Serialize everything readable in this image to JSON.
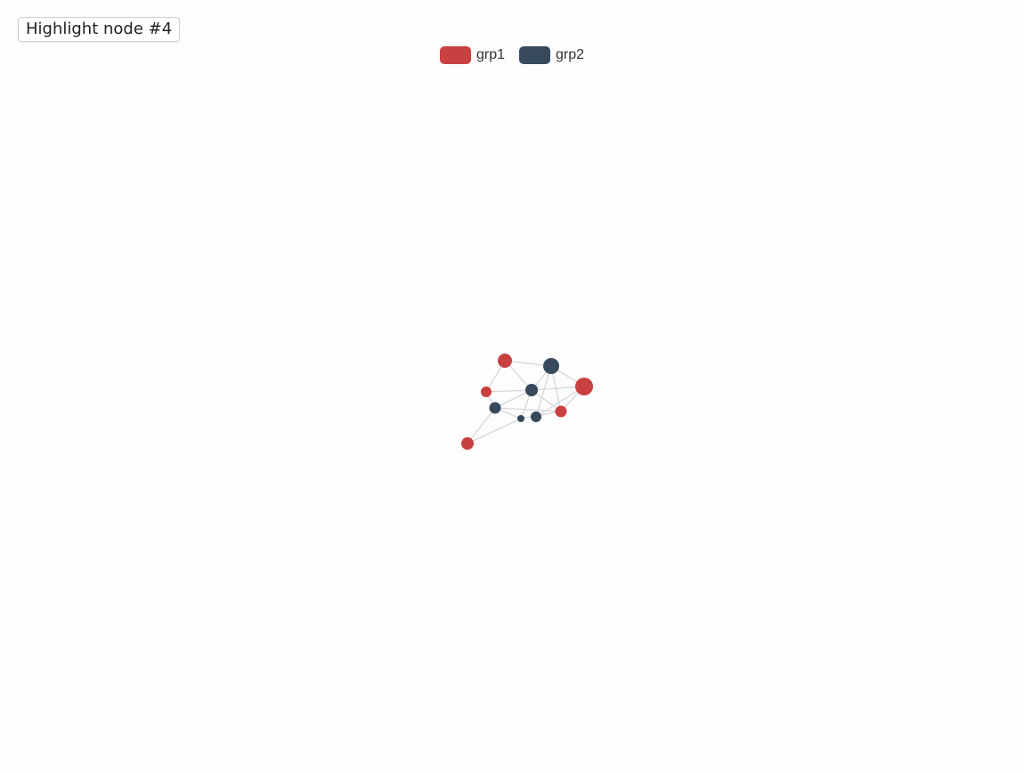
{
  "toolbar": {
    "highlight_label": "Highlight node #4"
  },
  "legend": [
    {
      "label": "grp1",
      "color": "#c94040"
    },
    {
      "label": "grp2",
      "color": "#364a5c"
    }
  ],
  "graph": {
    "edge_color": "#d6d6dc",
    "groups": {
      "grp1": "#c94040",
      "grp2": "#364a5c"
    },
    "nodes": [
      {
        "id": 0,
        "group": "grp1"
      },
      {
        "id": 1,
        "group": "grp2"
      },
      {
        "id": 2,
        "group": "grp1"
      },
      {
        "id": 3,
        "group": "grp1"
      },
      {
        "id": 4,
        "group": "grp2"
      },
      {
        "id": 5,
        "group": "grp2"
      },
      {
        "id": 6,
        "group": "grp1"
      },
      {
        "id": 7,
        "group": "grp2"
      },
      {
        "id": 8,
        "group": "grp2"
      },
      {
        "id": 9,
        "group": "grp1"
      }
    ],
    "edges": [
      [
        0,
        1
      ],
      [
        0,
        3
      ],
      [
        0,
        4
      ],
      [
        1,
        4
      ],
      [
        1,
        2
      ],
      [
        1,
        7
      ],
      [
        1,
        6
      ],
      [
        3,
        4
      ],
      [
        3,
        5
      ],
      [
        4,
        2
      ],
      [
        4,
        5
      ],
      [
        4,
        6
      ],
      [
        4,
        8
      ],
      [
        5,
        8
      ],
      [
        5,
        9
      ],
      [
        5,
        6
      ],
      [
        2,
        6
      ],
      [
        2,
        7
      ],
      [
        8,
        9
      ],
      [
        8,
        6
      ]
    ]
  }
}
